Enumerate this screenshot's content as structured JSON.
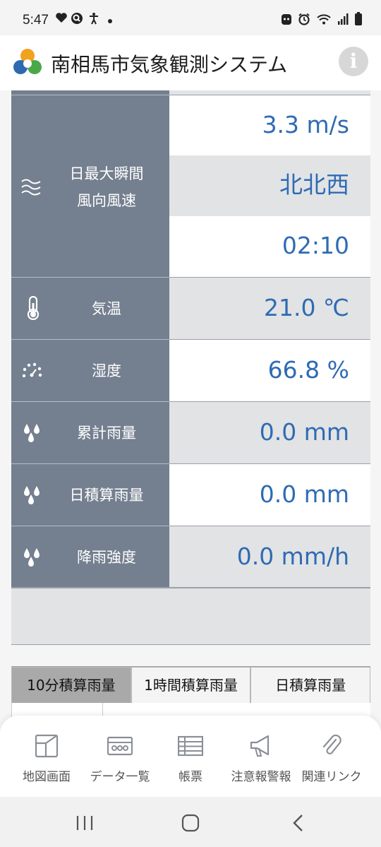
{
  "status_bar": {
    "time": "5:47",
    "left_icons": [
      "heart-icon",
      "search-icon",
      "accessibility-icon",
      "dot-icon"
    ],
    "right_icons": [
      "alarm-face-icon",
      "alarm-icon",
      "wifi-icon",
      "signal-icon",
      "battery-icon"
    ]
  },
  "header": {
    "title": "南相馬市気象観測システム",
    "info_icon": "info-icon"
  },
  "weather": {
    "wind": {
      "label_line1": "日最大瞬間",
      "label_line2": "風向風速",
      "icon": "wind-icon",
      "speed": "3.3 m/s",
      "direction": "北北西",
      "time": "02:10"
    },
    "rows": [
      {
        "label": "気温",
        "icon": "thermometer-icon",
        "value": "21.0 ℃"
      },
      {
        "label": "湿度",
        "icon": "humidity-icon",
        "value": "66.8 %"
      },
      {
        "label": "累計雨量",
        "icon": "rain-icon",
        "value": "0.0 mm"
      },
      {
        "label": "日積算雨量",
        "icon": "rain-icon",
        "value": "0.0 mm"
      },
      {
        "label": "降雨強度",
        "icon": "rain-icon",
        "value": "0.0 mm/h"
      }
    ]
  },
  "tabs": [
    {
      "label": "10分積算雨量",
      "active": true
    },
    {
      "label": "1時間積算雨量",
      "active": false
    },
    {
      "label": "日積算雨量",
      "active": false
    }
  ],
  "bottom_nav": [
    {
      "label": "地図画面",
      "icon": "map-icon"
    },
    {
      "label": "データ一覧",
      "icon": "data-list-icon"
    },
    {
      "label": "帳票",
      "icon": "table-icon"
    },
    {
      "label": "注意報警報",
      "icon": "megaphone-icon"
    },
    {
      "label": "関連リンク",
      "icon": "paperclip-icon"
    }
  ],
  "system_nav": [
    "recent-apps-icon",
    "home-icon",
    "back-icon"
  ],
  "colors": {
    "label_bg": "#747f8f",
    "value_text": "#2f6bb3",
    "active_tab": "#a9a9a9"
  }
}
